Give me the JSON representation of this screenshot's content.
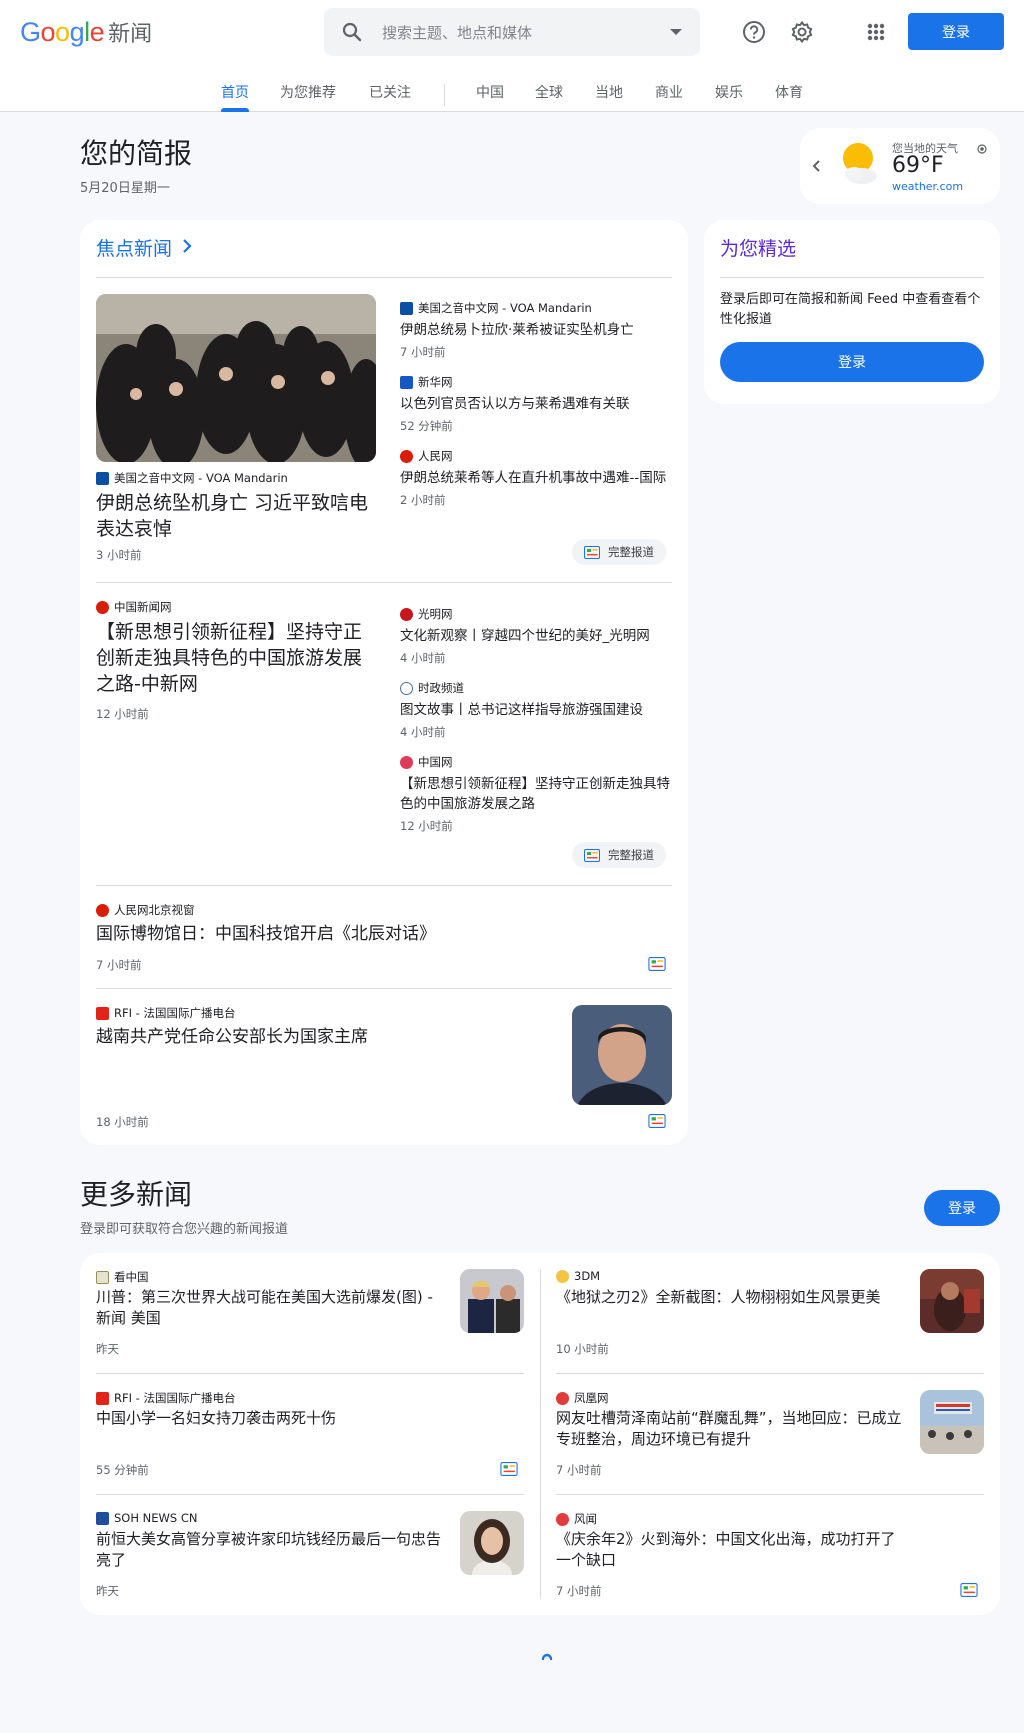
{
  "header": {
    "logo_google": [
      "G",
      "o",
      "o",
      "g",
      "l",
      "e"
    ],
    "logo_product": "新闻",
    "search_placeholder": "搜索主题、地点和媒体",
    "login": "登录",
    "icons": [
      "help-icon",
      "settings-icon",
      "apps-grid-icon"
    ]
  },
  "tabs": {
    "items": [
      "首页",
      "为您推荐",
      "已关注",
      "中国",
      "全球",
      "当地",
      "商业",
      "娱乐",
      "体育"
    ],
    "active": "首页"
  },
  "briefing": {
    "title": "您的简报",
    "date": "5月20日星期一"
  },
  "weather": {
    "label": "您当地的天气",
    "temp": "69°F",
    "source": "weather.com"
  },
  "top_stories": {
    "title": "焦点新闻",
    "full_coverage": "完整报道",
    "cluster1": {
      "main": {
        "source": "美国之音中文网 - VOA Mandarin",
        "headline": "伊朗总统坠机身亡 习近平致唁电表达哀悼",
        "time": "3 小时前"
      },
      "related": [
        {
          "source": "美国之音中文网 - VOA Mandarin",
          "headline": "伊朗总统易卜拉欣·莱希被证实坠机身亡",
          "time": "7 小时前"
        },
        {
          "source": "新华网",
          "headline": "以色列官员否认以方与莱希遇难有关联",
          "time": "52 分钟前"
        },
        {
          "source": "人民网",
          "headline": "伊朗总统莱希等人在直升机事故中遇难--国际",
          "time": "2 小时前"
        }
      ]
    },
    "cluster2": {
      "main": {
        "source": "中国新闻网",
        "headline": "【新思想引领新征程】坚持守正创新走独具特色的中国旅游发展之路-中新网",
        "time": "12 小时前"
      },
      "related": [
        {
          "source": "光明网",
          "headline": "文化新观察丨穿越四个世纪的美好_光明网",
          "time": "4 小时前"
        },
        {
          "source": "时政频道",
          "headline": "图文故事丨总书记这样指导旅游强国建设",
          "time": "4 小时前"
        },
        {
          "source": "中国网",
          "headline": "【新思想引领新征程】坚持守正创新走独具特色的中国旅游发展之路",
          "time": "12 小时前"
        }
      ]
    },
    "single1": {
      "source": "人民网北京视窗",
      "headline": "国际博物馆日：中国科技馆开启《北辰对话》",
      "time": "7 小时前"
    },
    "single2": {
      "source": "RFI - 法国国际广播电台",
      "headline": "越南共产党任命公安部长为国家主席",
      "time": "18 小时前"
    }
  },
  "picks": {
    "title": "为您精选",
    "desc": "登录后即可在简报和新闻 Feed 中查看查看个性化报道",
    "login": "登录"
  },
  "more": {
    "title": "更多新闻",
    "sub": "登录即可获取符合您兴趣的新闻报道",
    "login": "登录",
    "items": [
      {
        "source": "看中国",
        "headline": "川普：第三次世界大战可能在美国大选前爆发(图) - 新闻 美国",
        "time": "昨天"
      },
      {
        "source": "3DM",
        "headline": "《地狱之刃2》全新截图：人物栩栩如生风景更美",
        "time": "10 小时前"
      },
      {
        "source": "RFI - 法国国际广播电台",
        "headline": "中国小学一名妇女持刀袭击两死十伤",
        "time": "55 分钟前"
      },
      {
        "source": "凤凰网",
        "headline": "网友吐槽菏泽南站前“群魔乱舞”，当地回应：已成立专班整治，周边环境已有提升",
        "time": "7 小时前"
      },
      {
        "source": "SOH  NEWS  CN",
        "headline": "前恒大美女高管分享被许家印坑钱经历最后一句忠告亮了",
        "time": "昨天"
      },
      {
        "source": "风闻",
        "headline": "《庆余年2》火到海外：中国文化出海，成功打开了一个缺口",
        "time": "7 小时前"
      }
    ]
  },
  "colors": {
    "accent": "#1a73e8",
    "picks_title": "#5d2ad6",
    "bg": "#f6f8fc"
  }
}
